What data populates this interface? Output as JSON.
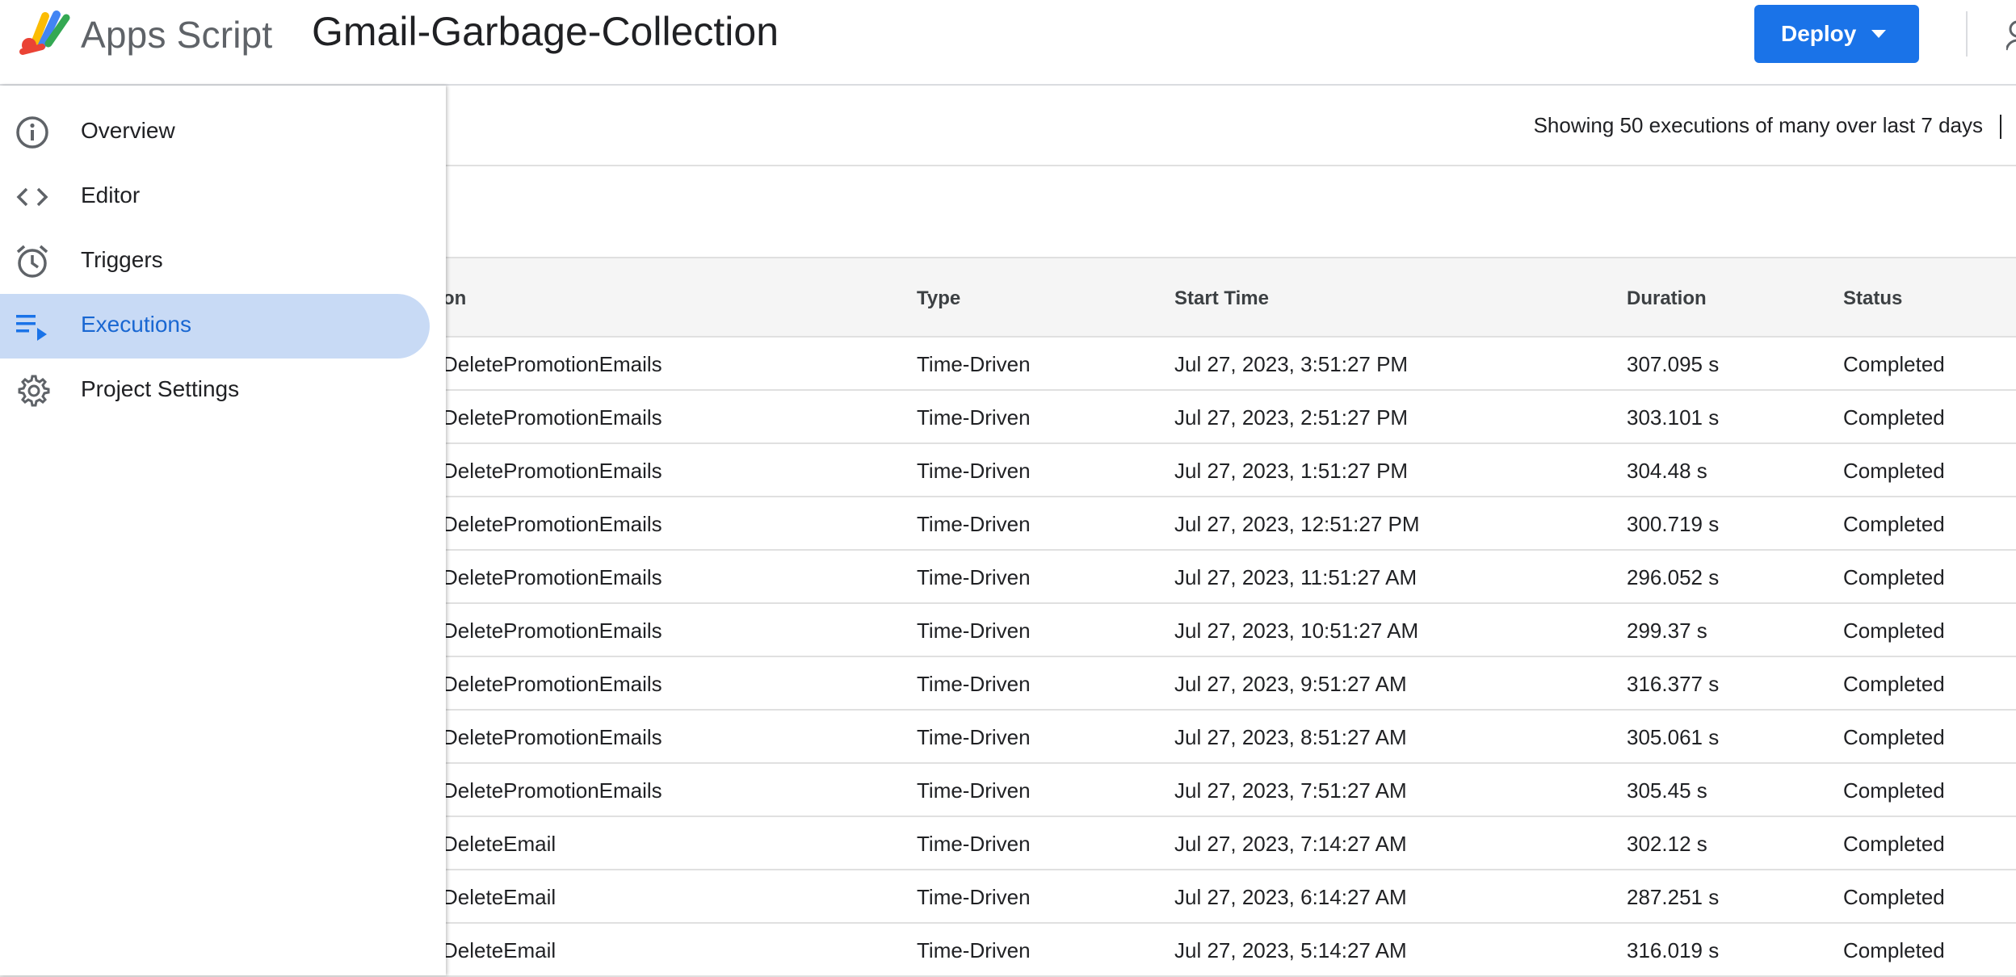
{
  "header": {
    "brand": "Apps Script",
    "project_title": "Gmail-Garbage-Collection",
    "deploy_label": "Deploy"
  },
  "summary": {
    "text": "Showing 50 executions of many over last 7 days"
  },
  "sidebar": {
    "items": [
      {
        "label": "Overview",
        "icon": "info-icon"
      },
      {
        "label": "Editor",
        "icon": "code-icon"
      },
      {
        "label": "Triggers",
        "icon": "alarm-clock-icon"
      },
      {
        "label": "Executions",
        "icon": "executions-list-icon",
        "active": true
      },
      {
        "label": "Project Settings",
        "icon": "gear-icon"
      }
    ]
  },
  "table": {
    "headers": {
      "function": "on",
      "type": "Type",
      "start_time": "Start Time",
      "duration": "Duration",
      "status": "Status"
    },
    "rows": [
      {
        "function": "DeletePromotionEmails",
        "type": "Time-Driven",
        "start": "Jul 27, 2023, 3:51:27 PM",
        "duration": "307.095 s",
        "status": "Completed"
      },
      {
        "function": "DeletePromotionEmails",
        "type": "Time-Driven",
        "start": "Jul 27, 2023, 2:51:27 PM",
        "duration": "303.101 s",
        "status": "Completed"
      },
      {
        "function": "DeletePromotionEmails",
        "type": "Time-Driven",
        "start": "Jul 27, 2023, 1:51:27 PM",
        "duration": "304.48 s",
        "status": "Completed"
      },
      {
        "function": "DeletePromotionEmails",
        "type": "Time-Driven",
        "start": "Jul 27, 2023, 12:51:27 PM",
        "duration": "300.719 s",
        "status": "Completed"
      },
      {
        "function": "DeletePromotionEmails",
        "type": "Time-Driven",
        "start": "Jul 27, 2023, 11:51:27 AM",
        "duration": "296.052 s",
        "status": "Completed"
      },
      {
        "function": "DeletePromotionEmails",
        "type": "Time-Driven",
        "start": "Jul 27, 2023, 10:51:27 AM",
        "duration": "299.37 s",
        "status": "Completed"
      },
      {
        "function": "DeletePromotionEmails",
        "type": "Time-Driven",
        "start": "Jul 27, 2023, 9:51:27 AM",
        "duration": "316.377 s",
        "status": "Completed"
      },
      {
        "function": "DeletePromotionEmails",
        "type": "Time-Driven",
        "start": "Jul 27, 2023, 8:51:27 AM",
        "duration": "305.061 s",
        "status": "Completed"
      },
      {
        "function": "DeletePromotionEmails",
        "type": "Time-Driven",
        "start": "Jul 27, 2023, 7:51:27 AM",
        "duration": "305.45 s",
        "status": "Completed"
      },
      {
        "function": "DeleteEmail",
        "type": "Time-Driven",
        "start": "Jul 27, 2023, 7:14:27 AM",
        "duration": "302.12 s",
        "status": "Completed"
      },
      {
        "function": "DeleteEmail",
        "type": "Time-Driven",
        "start": "Jul 27, 2023, 6:14:27 AM",
        "duration": "287.251 s",
        "status": "Completed"
      },
      {
        "function": "DeleteEmail",
        "type": "Time-Driven",
        "start": "Jul 27, 2023, 5:14:27 AM",
        "duration": "316.019 s",
        "status": "Completed"
      }
    ]
  },
  "colors": {
    "accent": "#1a73e8",
    "active_nav_bg": "#c8daf5",
    "active_nav_text": "#1967d2"
  }
}
